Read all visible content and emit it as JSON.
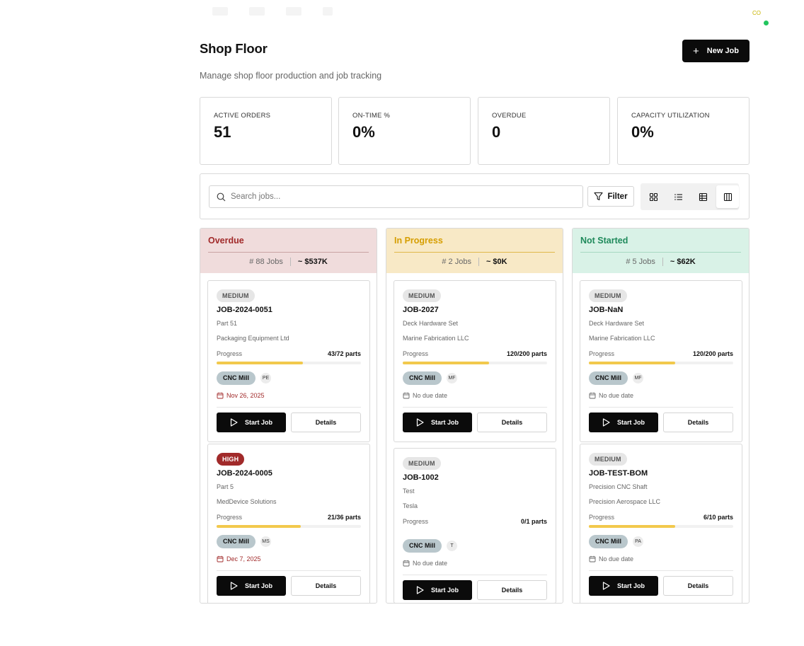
{
  "header": {
    "user_initials": "CO",
    "title": "Shop Floor",
    "subtitle": "Manage shop floor production and job tracking",
    "new_job_label": "New Job"
  },
  "stats": [
    {
      "label": "ACTIVE ORDERS",
      "value": "51"
    },
    {
      "label": "ON-TIME %",
      "value": "0%"
    },
    {
      "label": "OVERDUE",
      "value": "0"
    },
    {
      "label": "CAPACITY UTILIZATION",
      "value": "0%"
    }
  ],
  "toolbar": {
    "search_placeholder": "Search jobs...",
    "filter_label": "Filter",
    "views": [
      "grid-view-icon",
      "list-view-icon",
      "table-view-icon",
      "kanban-view-icon"
    ],
    "active_view": "kanban-view-icon"
  },
  "colors": {
    "overdue_header": "#f0dcdc",
    "overdue_text": "#a12a2a",
    "in_progress_header": "#f8e9c6",
    "in_progress_text": "#d69e00",
    "not_started_header": "#d9f2e7",
    "not_started_text": "#1f8a5b",
    "progress_fill": "#f2c94c",
    "primary": "#0b0b0b"
  },
  "columns": [
    {
      "title": "Overdue",
      "jobs": "# 88 Jobs",
      "value": "~ $537K",
      "cards": [
        {
          "priority": "MEDIUM",
          "job": "JOB-2024-0051",
          "part": "Part 51",
          "customer": "Packaging Equipment Ltd",
          "progress_label": "Progress",
          "progress_count": "43/72 parts",
          "progress": 0.597,
          "machine": "CNC Mill",
          "initials": "PE",
          "due": "Nov 26, 2025",
          "start": "Start Job",
          "details": "Details"
        },
        {
          "priority": "HIGH",
          "job": "JOB-2024-0005",
          "part": "Part 5",
          "customer": "MedDevice Solutions",
          "progress_label": "Progress",
          "progress_count": "21/36 parts",
          "progress": 0.583,
          "machine": "CNC Mill",
          "initials": "MS",
          "due": "Dec 7, 2025",
          "start": "Start Job",
          "details": "Details"
        }
      ]
    },
    {
      "title": "In Progress",
      "jobs": "# 2 Jobs",
      "value": "~ $0K",
      "cards": [
        {
          "priority": "MEDIUM",
          "job": "JOB-2027",
          "part": "Deck Hardware Set",
          "customer": "Marine Fabrication LLC",
          "progress_label": "Progress",
          "progress_count": "120/200 parts",
          "progress": 0.6,
          "machine": "CNC Mill",
          "initials": "MF",
          "due": "No due date",
          "start": "Start Job",
          "details": "Details"
        },
        {
          "priority": "MEDIUM",
          "job": "JOB-1002",
          "part": "Test",
          "customer": "Tesla",
          "progress_label": "Progress",
          "progress_count": "0/1 parts",
          "progress": 0,
          "machine": "CNC Mill",
          "initials": "T",
          "due": "No due date",
          "start": "Start Job",
          "details": "Details"
        }
      ]
    },
    {
      "title": "Not Started",
      "jobs": "# 5 Jobs",
      "value": "~ $62K",
      "cards": [
        {
          "priority": "MEDIUM",
          "job": "JOB-NaN",
          "part": "Deck Hardware Set",
          "customer": "Marine Fabrication LLC",
          "progress_label": "Progress",
          "progress_count": "120/200 parts",
          "progress": 0.6,
          "machine": "CNC Mill",
          "initials": "MF",
          "due": "No due date",
          "start": "Start Job",
          "details": "Details"
        },
        {
          "priority": "MEDIUM",
          "job": "JOB-TEST-BOM",
          "part": "Precision CNC Shaft",
          "customer": "Precision Aerospace LLC",
          "progress_label": "Progress",
          "progress_count": "6/10 parts",
          "progress": 0.6,
          "machine": "CNC Mill",
          "initials": "PA",
          "due": "No due date",
          "start": "Start Job",
          "details": "Details"
        }
      ]
    }
  ]
}
